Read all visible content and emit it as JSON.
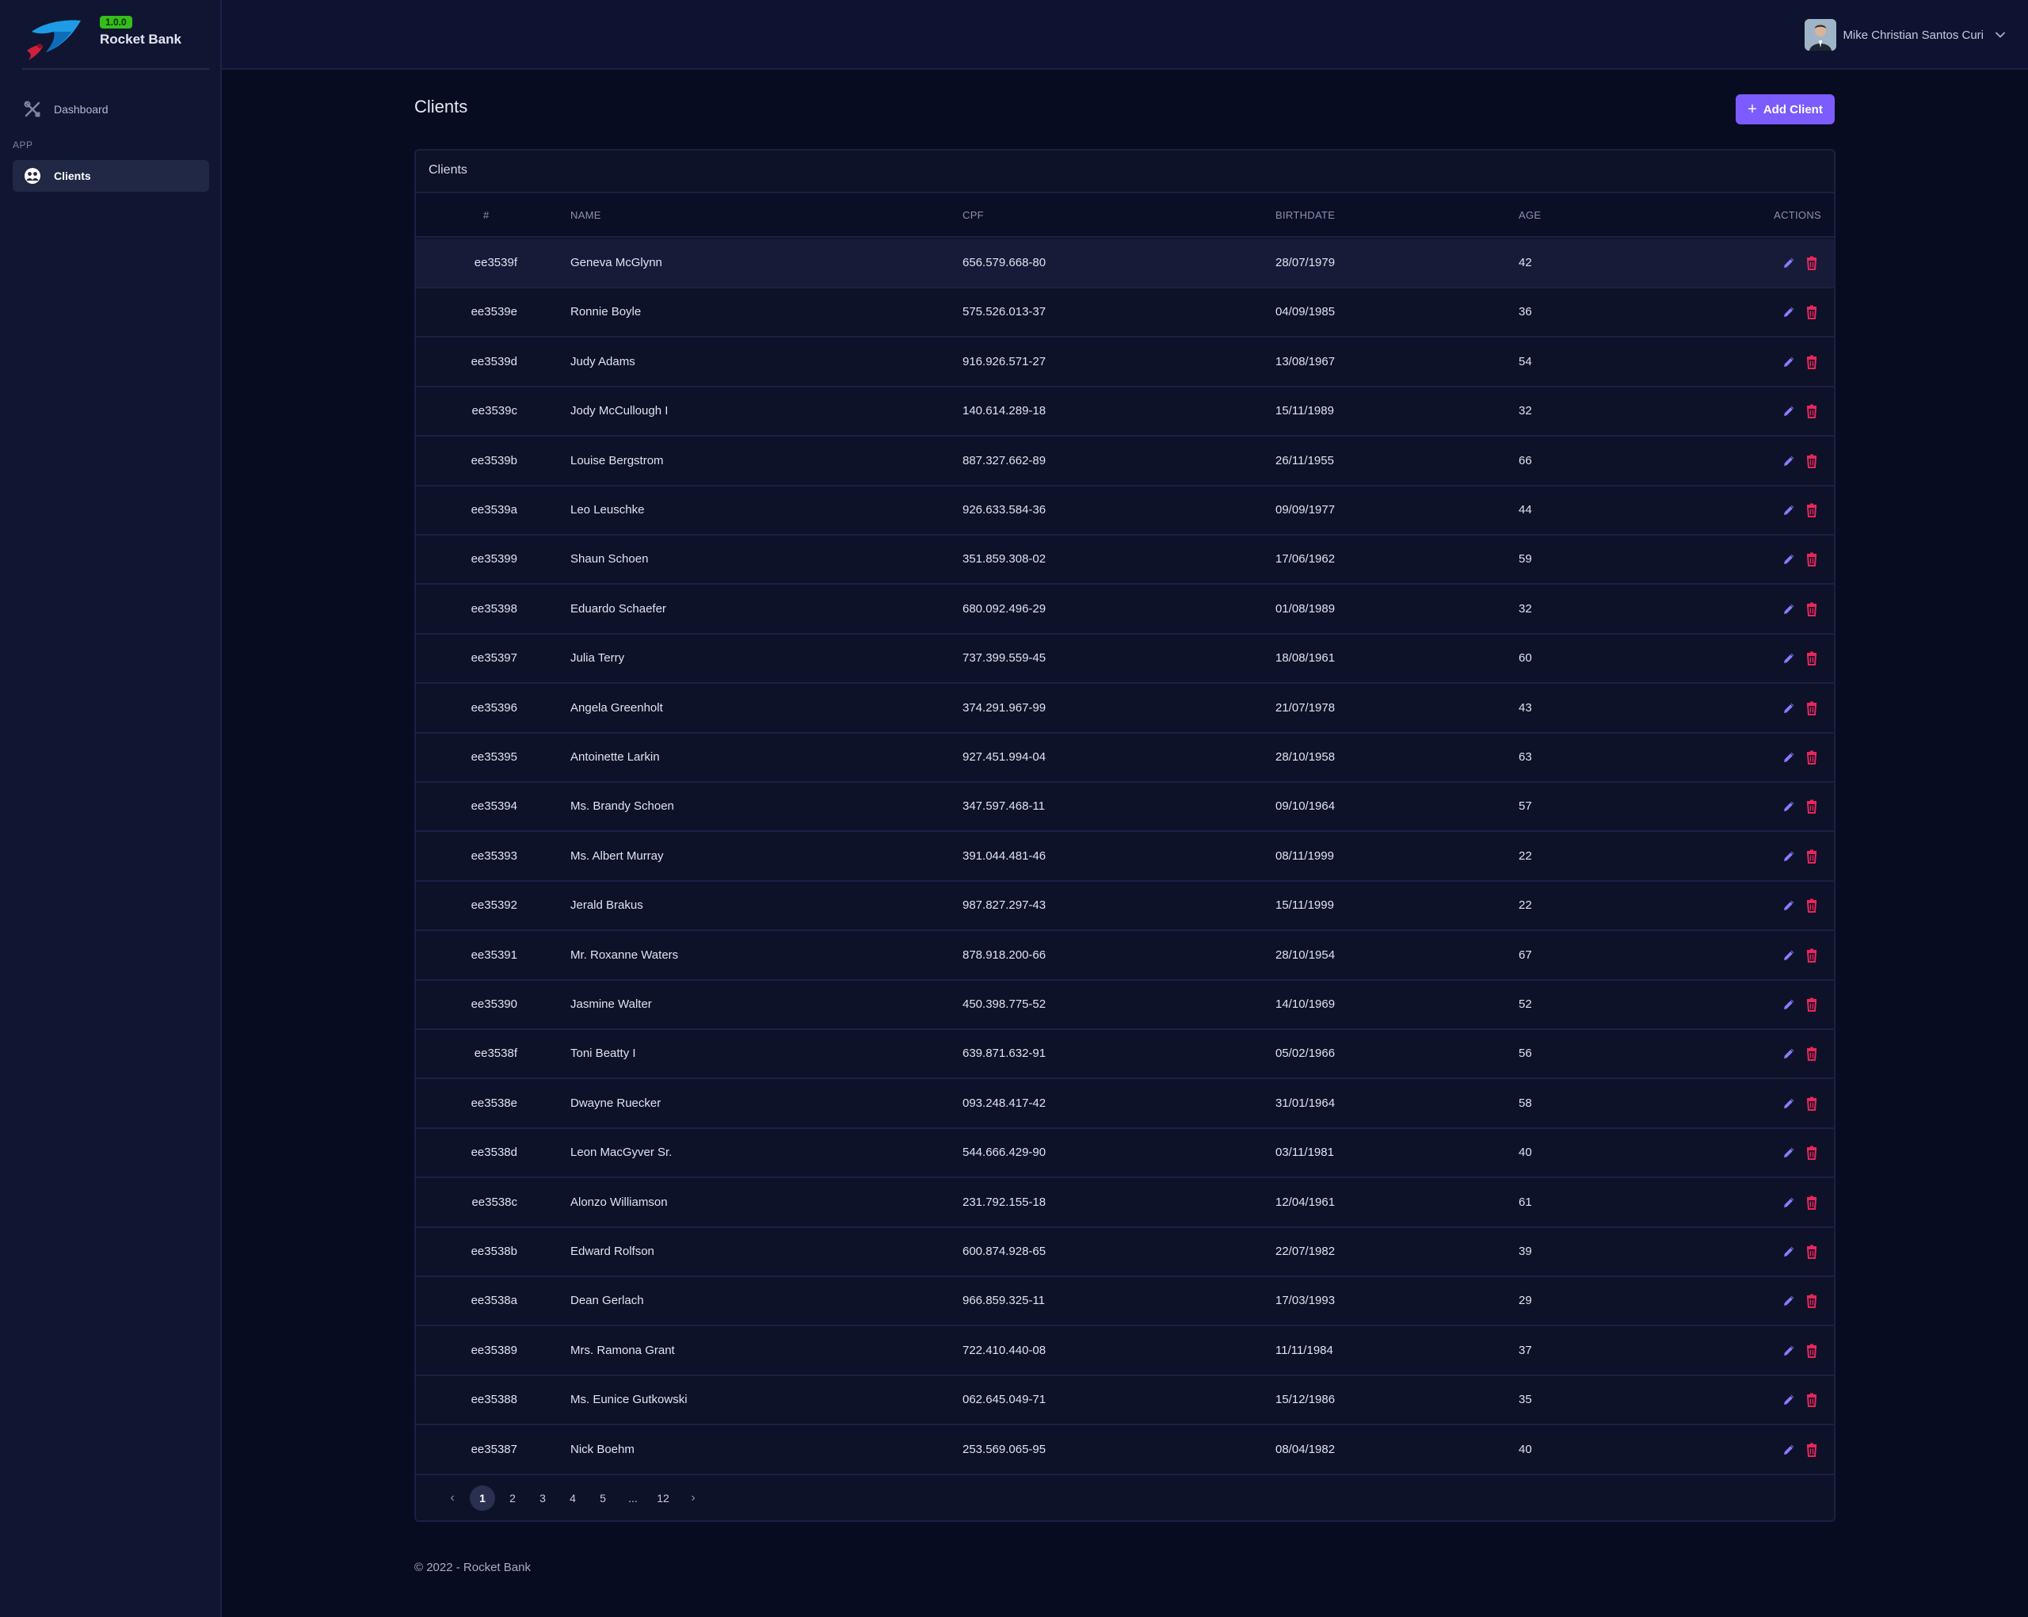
{
  "brand": {
    "version": "1.0.0",
    "name": "Rocket Bank"
  },
  "sidebar": {
    "dashboard_label": "Dashboard",
    "section_label": "APP",
    "clients_label": "Clients"
  },
  "topbar": {
    "user_name": "Mike Christian Santos Curi"
  },
  "main": {
    "title": "Clients",
    "add_button": "Add Client",
    "card_title": "Clients"
  },
  "table": {
    "columns": [
      "#",
      "NAME",
      "CPF",
      "BIRTHDATE",
      "AGE",
      "ACTIONS"
    ],
    "rows": [
      [
        "ee3539f",
        "Geneva McGlynn",
        "656.579.668-80",
        "28/07/1979",
        "42"
      ],
      [
        "ee3539e",
        "Ronnie Boyle",
        "575.526.013-37",
        "04/09/1985",
        "36"
      ],
      [
        "ee3539d",
        "Judy Adams",
        "916.926.571-27",
        "13/08/1967",
        "54"
      ],
      [
        "ee3539c",
        "Jody McCullough I",
        "140.614.289-18",
        "15/11/1989",
        "32"
      ],
      [
        "ee3539b",
        "Louise Bergstrom",
        "887.327.662-89",
        "26/11/1955",
        "66"
      ],
      [
        "ee3539a",
        "Leo Leuschke",
        "926.633.584-36",
        "09/09/1977",
        "44"
      ],
      [
        "ee35399",
        "Shaun Schoen",
        "351.859.308-02",
        "17/06/1962",
        "59"
      ],
      [
        "ee35398",
        "Eduardo Schaefer",
        "680.092.496-29",
        "01/08/1989",
        "32"
      ],
      [
        "ee35397",
        "Julia Terry",
        "737.399.559-45",
        "18/08/1961",
        "60"
      ],
      [
        "ee35396",
        "Angela Greenholt",
        "374.291.967-99",
        "21/07/1978",
        "43"
      ],
      [
        "ee35395",
        "Antoinette Larkin",
        "927.451.994-04",
        "28/10/1958",
        "63"
      ],
      [
        "ee35394",
        "Ms. Brandy Schoen",
        "347.597.468-11",
        "09/10/1964",
        "57"
      ],
      [
        "ee35393",
        "Ms. Albert Murray",
        "391.044.481-46",
        "08/11/1999",
        "22"
      ],
      [
        "ee35392",
        "Jerald Brakus",
        "987.827.297-43",
        "15/11/1999",
        "22"
      ],
      [
        "ee35391",
        "Mr. Roxanne Waters",
        "878.918.200-66",
        "28/10/1954",
        "67"
      ],
      [
        "ee35390",
        "Jasmine Walter",
        "450.398.775-52",
        "14/10/1969",
        "52"
      ],
      [
        "ee3538f",
        "Toni Beatty I",
        "639.871.632-91",
        "05/02/1966",
        "56"
      ],
      [
        "ee3538e",
        "Dwayne Ruecker",
        "093.248.417-42",
        "31/01/1964",
        "58"
      ],
      [
        "ee3538d",
        "Leon MacGyver Sr.",
        "544.666.429-90",
        "03/11/1981",
        "40"
      ],
      [
        "ee3538c",
        "Alonzo Williamson",
        "231.792.155-18",
        "12/04/1961",
        "61"
      ],
      [
        "ee3538b",
        "Edward Rolfson",
        "600.874.928-65",
        "22/07/1982",
        "39"
      ],
      [
        "ee3538a",
        "Dean Gerlach",
        "966.859.325-11",
        "17/03/1993",
        "29"
      ],
      [
        "ee35389",
        "Mrs. Ramona Grant",
        "722.410.440-08",
        "11/11/1984",
        "37"
      ],
      [
        "ee35388",
        "Ms. Eunice Gutkowski",
        "062.645.049-71",
        "15/12/1986",
        "35"
      ],
      [
        "ee35387",
        "Nick Boehm",
        "253.569.065-95",
        "08/04/1982",
        "40"
      ]
    ]
  },
  "pagination": {
    "prev": "‹",
    "pages": [
      "1",
      "2",
      "3",
      "4",
      "5",
      "...",
      "12"
    ],
    "next": "›",
    "current": "1"
  },
  "footer": {
    "text": "© 2022 - Rocket Bank"
  },
  "colors": {
    "accent": "#7c5cff",
    "edit_icon": "#8b7cff",
    "delete_icon": "#e8265a",
    "version_badge": "#34c019"
  },
  "icons": {
    "dashboard": "tools-icon",
    "clients": "people-icon",
    "edit": "pencil-icon",
    "delete": "trash-icon",
    "user_menu": "chevron-down-icon"
  }
}
